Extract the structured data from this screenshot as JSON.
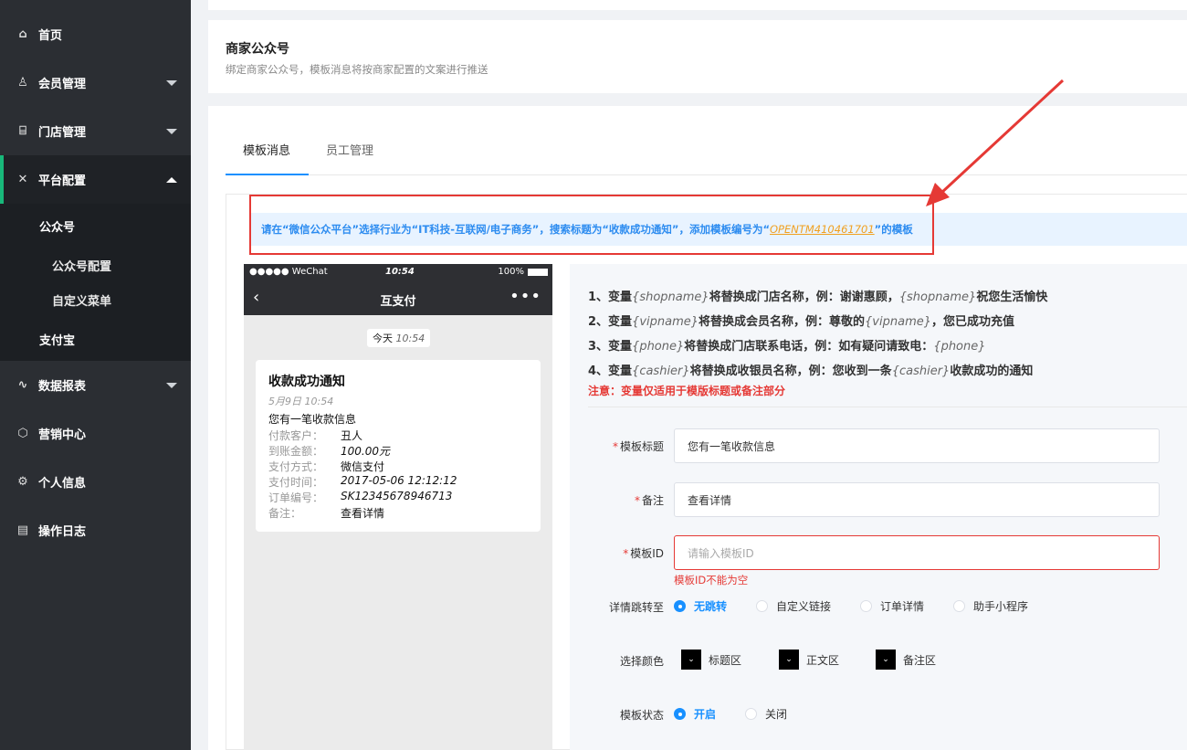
{
  "sidebar": {
    "items": [
      {
        "label": "首页",
        "icon": "home-icon"
      },
      {
        "label": "会员管理",
        "icon": "user-icon"
      },
      {
        "label": "门店管理",
        "icon": "store-icon"
      },
      {
        "label": "平台配置",
        "icon": "tools-icon"
      },
      {
        "label": "数据报表",
        "icon": "chart-icon"
      },
      {
        "label": "营销中心",
        "icon": "box-icon"
      },
      {
        "label": "个人信息",
        "icon": "gear-icon"
      },
      {
        "label": "操作日志",
        "icon": "log-icon"
      }
    ],
    "sub": {
      "gzh": "公众号",
      "gzh_config": "公众号配置",
      "custom_menu": "自定义菜单",
      "alipay": "支付宝"
    }
  },
  "header": {
    "title": "商家公众号",
    "subtitle": "绑定商家公众号，模板消息将按商家配置的文案进行推送"
  },
  "tabs": {
    "active": "模板消息",
    "other": "员工管理"
  },
  "notice": {
    "prefix": "请在“微信公众平台”选择行业为“IT科技-互联网/电子商务”，搜索标题为“收款成功通知”，添加模板编号为“",
    "code": "OPENTM410461701",
    "suffix": "”的模板"
  },
  "phone": {
    "carrier": "●●●●● WeChat",
    "time": "10:54",
    "battery": "100%",
    "title": "互支付",
    "date_label": "今天",
    "date_time": "10:54",
    "msg": {
      "title": "收款成功通知",
      "date": "5月9日 10:54",
      "first": "您有一笔收款信息",
      "rows": [
        {
          "k": "付款客户：",
          "v": "丑人"
        },
        {
          "k": "到账金额：",
          "v": "100.00元"
        },
        {
          "k": "支付方式：",
          "v": "微信支付"
        },
        {
          "k": "支付时间：",
          "v": "2017-05-06 12:12:12"
        },
        {
          "k": "订单编号：",
          "v": "SK12345678946713"
        },
        {
          "k": "备注：",
          "v": "查看详情"
        }
      ]
    }
  },
  "vars": {
    "lines": [
      {
        "pre": "1、变量",
        "var": "{shopname}",
        "mid": "将替换成门店名称，例：谢谢惠顾，",
        "var2": "{shopname}",
        "post": "祝您生活愉快"
      },
      {
        "pre": "2、变量",
        "var": "{vipname}",
        "mid": "将替换成会员名称，例：尊敬的",
        "var2": "{vipname}",
        "post": "，您已成功充值"
      },
      {
        "pre": "3、变量",
        "var": "{phone}",
        "mid": "将替换成门店联系电话，例：如有疑问请致电：",
        "var2": "{phone}",
        "post": ""
      },
      {
        "pre": "4、变量",
        "var": "{cashier}",
        "mid": "将替换成收银员名称，例：您收到一条",
        "var2": "{cashier}",
        "post": "收款成功的通知"
      }
    ],
    "note": "注意：变量仅适用于模版标题或备注部分"
  },
  "form": {
    "title_label": "模板标题",
    "title_value": "您有一笔收款信息",
    "remark_label": "备注",
    "remark_value": "查看详情",
    "id_label": "模板ID",
    "id_placeholder": "请输入模板ID",
    "id_error": "模板ID不能为空",
    "jump_label": "详情跳转至",
    "jump_options": [
      "无跳转",
      "自定义链接",
      "订单详情",
      "助手小程序"
    ],
    "color_label": "选择颜色",
    "color_options": [
      "标题区",
      "正文区",
      "备注区"
    ],
    "status_label": "模板状态",
    "status_options": [
      "开启",
      "关闭"
    ]
  }
}
